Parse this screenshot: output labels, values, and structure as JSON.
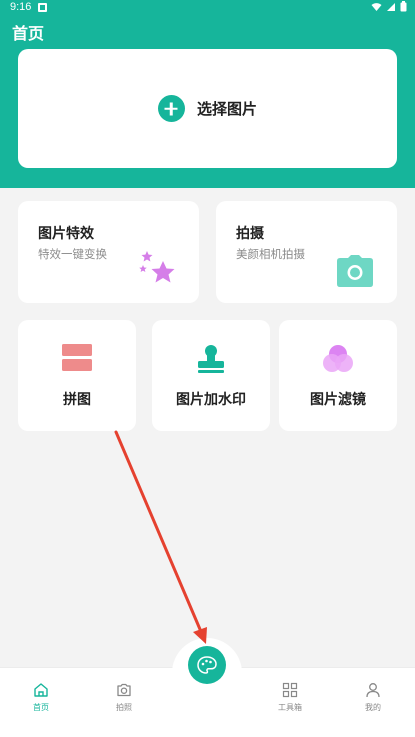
{
  "status_bar": {
    "time": "9:16"
  },
  "app": {
    "title": "首页"
  },
  "select_card": {
    "label": "选择图片"
  },
  "cards": {
    "effect": {
      "title": "图片特效",
      "subtitle": "特效一键变换"
    },
    "shoot": {
      "title": "拍摄",
      "subtitle": "美颜相机拍摄"
    },
    "puzzle": {
      "label": "拼图"
    },
    "watermark": {
      "label": "图片加水印"
    },
    "filter": {
      "label": "图片滤镜"
    }
  },
  "bottom_nav": {
    "home": "首页",
    "photo": "拍照",
    "tools": "工具箱",
    "mine": "我的"
  },
  "colors": {
    "accent": "#16b59b",
    "puzzle_icon": "#ee8b8b",
    "star_icon": "#d57ee8",
    "camera_icon": "#6ed7c4",
    "filter_icon": "#e59cf5",
    "annotation_arrow": "#e5412f"
  },
  "icons": {
    "fab": "palette-icon"
  }
}
